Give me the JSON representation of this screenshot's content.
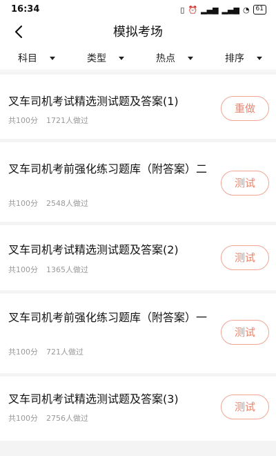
{
  "status_bar": {
    "time": "16:34",
    "battery": "61"
  },
  "nav": {
    "title": "模拟考场"
  },
  "filters": [
    {
      "label": "科目"
    },
    {
      "label": "类型"
    },
    {
      "label": "热点"
    },
    {
      "label": "排序"
    }
  ],
  "exams": [
    {
      "title": "叉车司机考试精选测试题及答案(1)",
      "total": "共100分",
      "participants": "1721人做过",
      "button": "重做"
    },
    {
      "title": "叉车司机考前强化练习题库（附答案）二",
      "total": "共100分",
      "participants": "2548人做过",
      "button": "测试"
    },
    {
      "title": "叉车司机考试精选测试题及答案(2)",
      "total": "共100分",
      "participants": "1365人做过",
      "button": "测试"
    },
    {
      "title": "叉车司机考前强化练习题库（附答案）一",
      "total": "共100分",
      "participants": "721人做过",
      "button": "测试"
    },
    {
      "title": "叉车司机考试精选测试题及答案(3)",
      "total": "共100分",
      "participants": "2756人做过",
      "button": "测试"
    }
  ],
  "colors": {
    "accent": "#e8846d",
    "button_border": "#f0a493",
    "meta_text": "#999999",
    "divider": "#f4f4f4"
  }
}
